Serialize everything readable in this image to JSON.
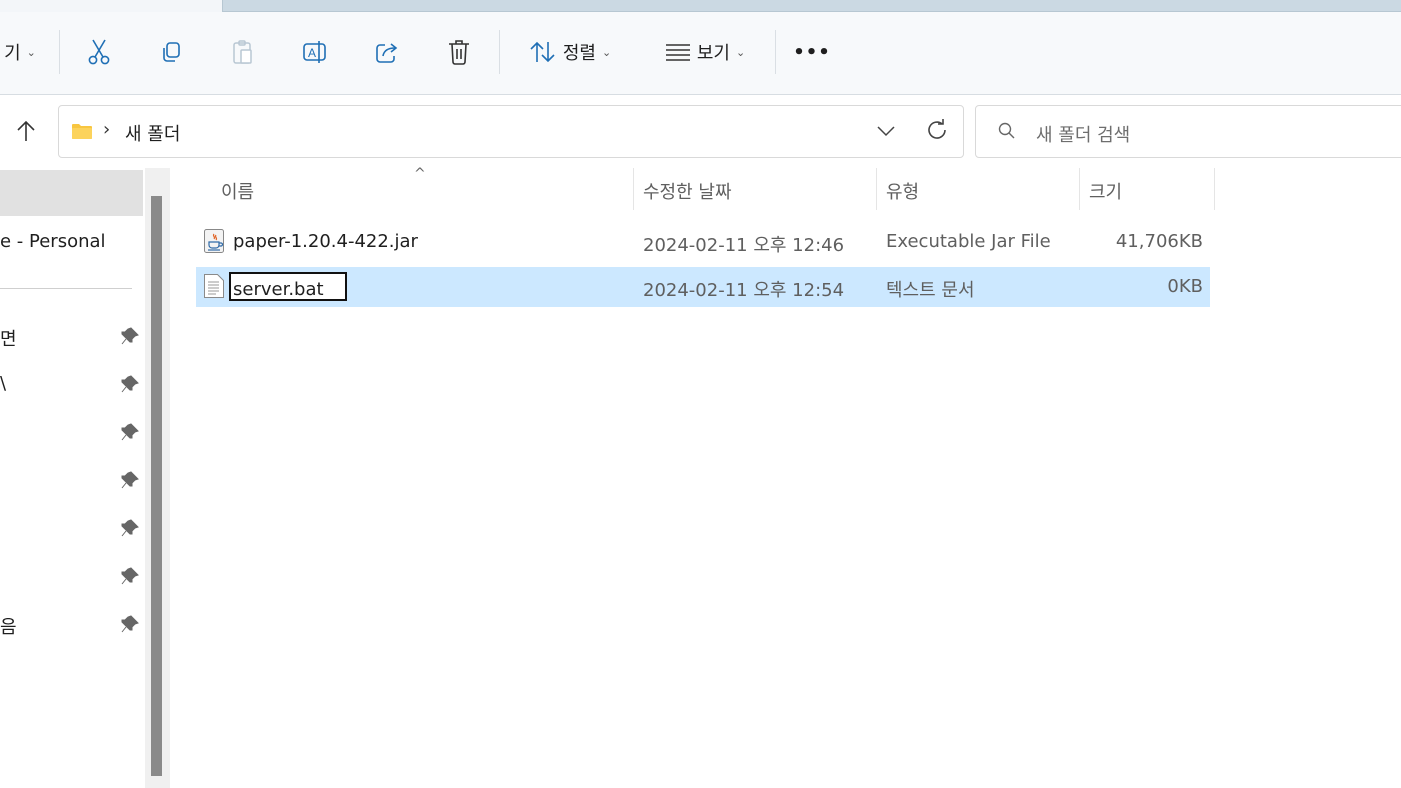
{
  "toolbar": {
    "new_partial": "기",
    "new_chevron": "⌄",
    "sort_label": "정렬",
    "view_label": "보기",
    "more_label": "•••",
    "chevron": "⌄"
  },
  "address": {
    "separator": "›",
    "crumb": "새 폴더",
    "search_placeholder": "새 폴더 검색"
  },
  "nav": {
    "personal": "e - Personal",
    "items": [
      {
        "label": "면"
      },
      {
        "label": "\\"
      },
      {
        "label": ""
      },
      {
        "label": ""
      },
      {
        "label": ""
      },
      {
        "label": ""
      },
      {
        "label": "음"
      }
    ]
  },
  "columns": {
    "name": "이름",
    "modified": "수정한 날짜",
    "type": "유형",
    "size": "크기",
    "sort_indicator": "^"
  },
  "files": [
    {
      "name": "paper-1.20.4-422.jar",
      "modified": "2024-02-11 오후 12:46",
      "type": "Executable Jar File",
      "size": "41,706KB",
      "icon": "java-jar-icon",
      "selected": false
    },
    {
      "name": "server.bat",
      "modified": "2024-02-11 오후 12:54",
      "type": "텍스트 문서",
      "size": "0KB",
      "icon": "text-file-icon",
      "selected": true,
      "renaming": true
    }
  ],
  "colors": {
    "selection": "#cce8ff",
    "folder": "#f8c640"
  }
}
